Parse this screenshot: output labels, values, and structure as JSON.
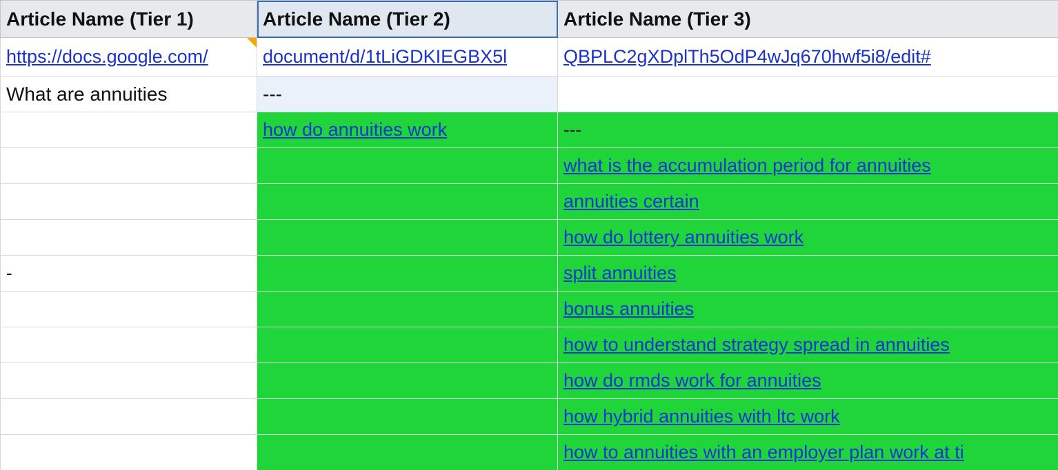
{
  "headers": {
    "tier1": "Article Name (Tier 1)",
    "tier2": "Article Name (Tier 2)",
    "tier3": "Article Name (Tier 3)"
  },
  "row_link": {
    "part1": "https://docs.google.com/",
    "part2": "document/d/1tLiGDKIEGBX5l",
    "part3": "QBPLC2gXDplTh5OdP4wJq670hwf5i8/edit#"
  },
  "row_base": {
    "tier1": "What are annuities",
    "tier2": "---",
    "tier3": ""
  },
  "tier2_link": "how do annuities work",
  "tier3_first": "---",
  "tier3_links": [
    "what is the accumulation period for annuities",
    "annuities certain",
    "how do lottery annuities work",
    "split annuities",
    "bonus annuities",
    "how to understand strategy spread in annuities",
    "how do rmds work for annuities",
    "how hybrid annuities with ltc work",
    "how to annuities with an employer plan work at ti"
  ],
  "tier1_dash": "-"
}
